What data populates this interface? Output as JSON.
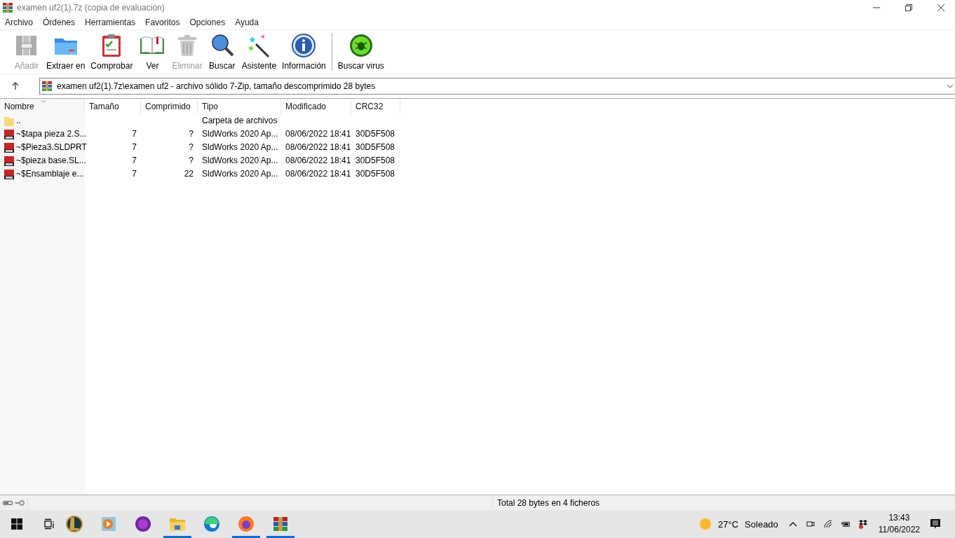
{
  "window": {
    "title": "examen uf2(1).7z (copia de evaluación)"
  },
  "menu": [
    "Archivo",
    "Órdenes",
    "Herramientas",
    "Favoritos",
    "Opciones",
    "Ayuda"
  ],
  "toolbar": [
    {
      "kind": "add",
      "label": "Añadir",
      "disabled": true
    },
    {
      "kind": "extract",
      "label": "Extraer en",
      "disabled": false
    },
    {
      "kind": "test",
      "label": "Comprobar",
      "disabled": false
    },
    {
      "kind": "view",
      "label": "Ver",
      "disabled": false
    },
    {
      "kind": "delete",
      "label": "Eliminar",
      "disabled": true
    },
    {
      "kind": "find",
      "label": "Buscar",
      "disabled": false
    },
    {
      "kind": "wizard",
      "label": "Asistente",
      "disabled": false
    },
    {
      "kind": "info",
      "label": "Información",
      "disabled": false
    },
    {
      "kind": "virus",
      "label": "Buscar virus",
      "disabled": false
    }
  ],
  "address": {
    "path": "examen uf2(1).7z\\examen uf2 - archivo sólido 7-Zip, tamaño descomprimido 28 bytes"
  },
  "table": {
    "columns": [
      "Nombre",
      "Tamaño",
      "Comprimido",
      "Tipo",
      "Modificado",
      "CRC32"
    ],
    "rows": [
      {
        "kind": "folder",
        "cells": [
          "..",
          "",
          "",
          "Carpeta de archivos",
          "",
          ""
        ]
      },
      {
        "kind": "file",
        "cells": [
          "~$tapa pieza 2.S...",
          "7",
          "?",
          "SldWorks 2020 Ap...",
          "08/06/2022 18:41",
          "30D5F508"
        ]
      },
      {
        "kind": "file",
        "cells": [
          "~$Pieza3.SLDPRT",
          "7",
          "?",
          "SldWorks 2020 Ap...",
          "08/06/2022 18:41",
          "30D5F508"
        ]
      },
      {
        "kind": "file",
        "cells": [
          "~$pieza base.SL...",
          "7",
          "?",
          "SldWorks 2020 Ap...",
          "08/06/2022 18:41",
          "30D5F508"
        ]
      },
      {
        "kind": "file",
        "cells": [
          "~$Ensamblaje e...",
          "7",
          "22",
          "SldWorks 2020 Ap...",
          "08/06/2022 18:41",
          "30D5F508"
        ]
      }
    ]
  },
  "status_bar": {
    "text": "Total 28 bytes en 4 ficheros"
  },
  "taskbar": {
    "apps": [
      {
        "kind": "lol",
        "running": false
      },
      {
        "kind": "player",
        "running": false
      },
      {
        "kind": "as",
        "running": false
      },
      {
        "kind": "explorer",
        "running": true
      },
      {
        "kind": "edge",
        "running": false
      },
      {
        "kind": "firefox",
        "running": true
      },
      {
        "kind": "winrar",
        "running": true
      }
    ],
    "weather": {
      "temperature": "27°C",
      "condition": "Soleado"
    },
    "clock": {
      "time": "13:43",
      "date": "11/06/2022"
    }
  }
}
